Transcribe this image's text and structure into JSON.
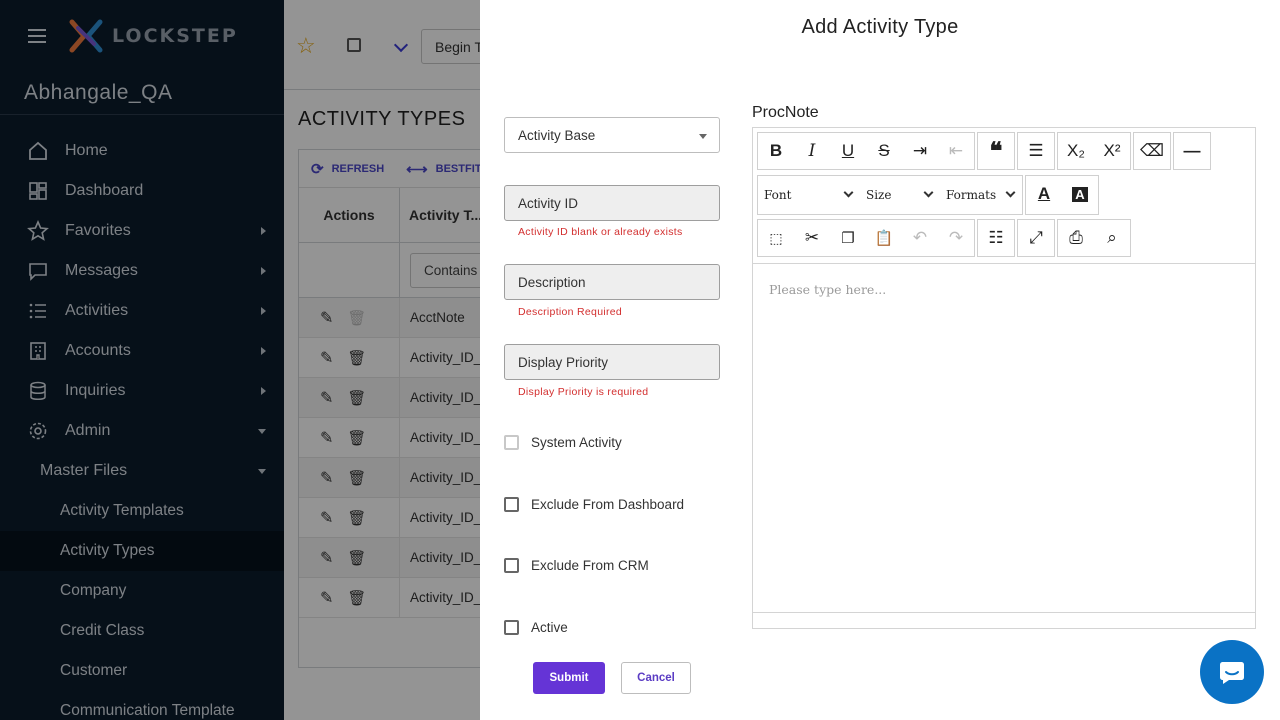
{
  "sidebar": {
    "logo_text": "LOCKSTEP",
    "tenant": "Abhangale_QA",
    "items": [
      {
        "label": "Home"
      },
      {
        "label": "Dashboard"
      },
      {
        "label": "Favorites"
      },
      {
        "label": "Messages"
      },
      {
        "label": "Activities"
      },
      {
        "label": "Accounts"
      },
      {
        "label": "Inquiries"
      },
      {
        "label": "Admin"
      }
    ],
    "master_files": "Master Files",
    "sub_items": [
      {
        "label": "Activity Templates"
      },
      {
        "label": "Activity Types"
      },
      {
        "label": "Company"
      },
      {
        "label": "Credit Class"
      },
      {
        "label": "Customer"
      },
      {
        "label": "Communication Template"
      }
    ]
  },
  "page": {
    "begin_text": "Begin T",
    "title": "ACTIVITY TYPES",
    "tools": {
      "refresh": "REFRESH",
      "bestfit": "BESTFIT"
    },
    "columns": {
      "actions": "Actions",
      "type": "Activity T..."
    },
    "filter": "Contains",
    "rows": [
      "AcctNote",
      "Activity_ID_",
      "Activity_ID_",
      "Activity_ID_",
      "Activity_ID_",
      "Activity_ID_",
      "Activity_ID_",
      "Activity_ID_"
    ]
  },
  "modal": {
    "title": "Add Activity Type",
    "base_select": "Activity Base",
    "activity_id_placeholder": "Activity ID",
    "activity_id_error": "Activity ID blank or already exists",
    "description_placeholder": "Description",
    "description_error": "Description Required",
    "display_priority_placeholder": "Display Priority",
    "display_priority_error": "Display Priority is required",
    "checkboxes": {
      "system": "System Activity",
      "exclude_dashboard": "Exclude From Dashboard",
      "exclude_crm": "Exclude From CRM",
      "active": "Active"
    },
    "submit": "Submit",
    "cancel": "Cancel",
    "editor": {
      "label": "ProcNote",
      "font": "Font",
      "size": "Size",
      "formats": "Formats",
      "placeholder": "Please type here..."
    }
  },
  "colors": {
    "sidebar_bg": "#0b1c2c",
    "accent": "#6534d6",
    "error": "#d32f2f",
    "chat": "#0a72c5"
  }
}
